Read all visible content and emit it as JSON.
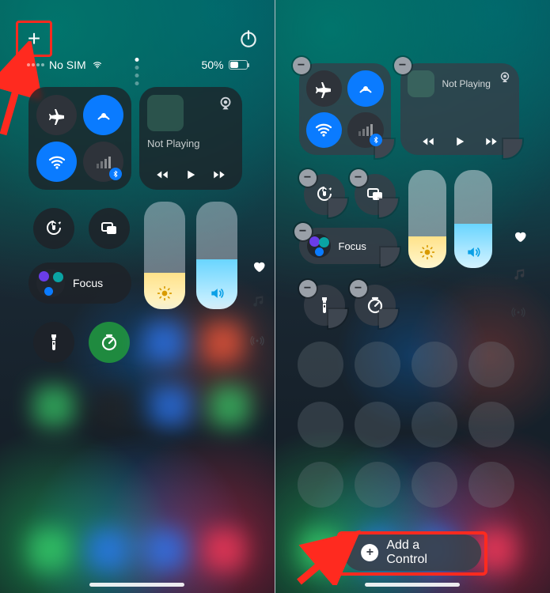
{
  "left": {
    "status": {
      "carrier": "No SIM",
      "battery_pct": "50%"
    },
    "media_label": "Not Playing",
    "focus_label": "Focus"
  },
  "right": {
    "media_label": "Not Playing",
    "focus_label": "Focus",
    "add_control_label": "Add a Control"
  }
}
